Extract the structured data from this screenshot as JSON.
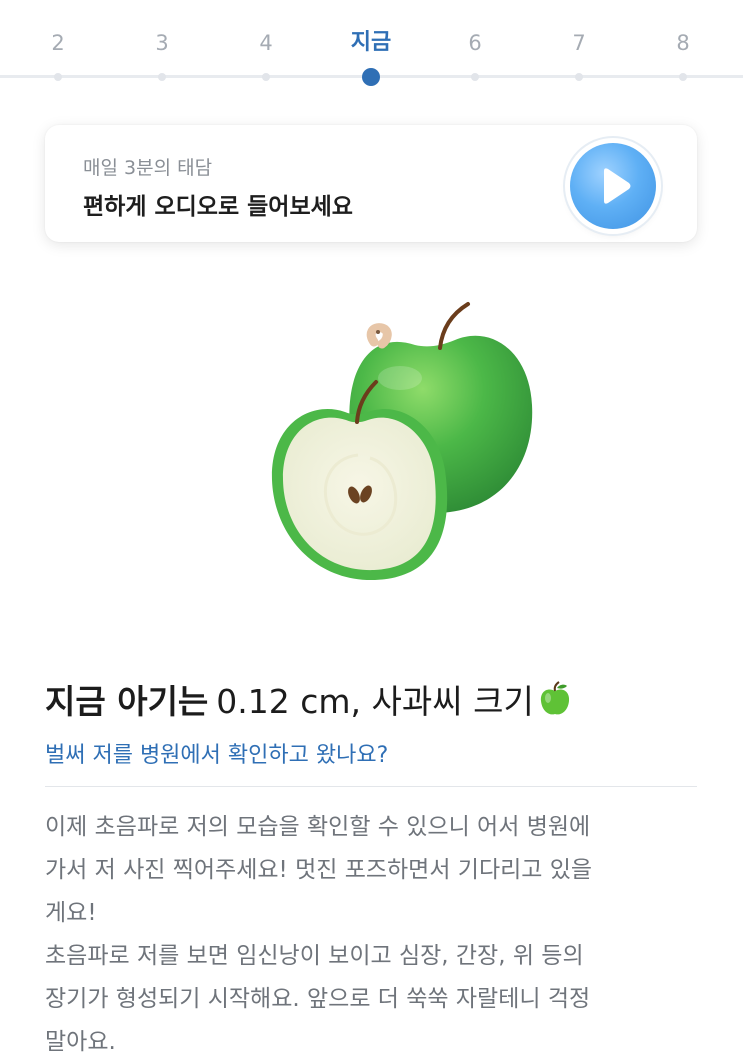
{
  "weeks": [
    {
      "label": "2",
      "active": false
    },
    {
      "label": "3",
      "active": false
    },
    {
      "label": "4",
      "active": false
    },
    {
      "label": "지금",
      "active": true
    },
    {
      "label": "6",
      "active": false
    },
    {
      "label": "7",
      "active": false
    },
    {
      "label": "8",
      "active": false
    }
  ],
  "audio": {
    "subtitle": "매일 3분의 태담",
    "title": "편하게 오디오로 들어보세요",
    "play_icon": "play-icon"
  },
  "illustration": {
    "icon": "green-apple-illustration"
  },
  "info": {
    "headline_bold": "지금 아기는",
    "headline_size": "0.12 cm, 사과씨 크기",
    "headline_emoji": "green-apple-icon",
    "question": "벌써 저를 병원에서 확인하고 왔나요?",
    "lines": [
      "이제 초음파로 저의 모습을 확인할 수 있으니 어서 병원에",
      "가서 저 사진 찍어주세요! 멋진 포즈하면서 기다리고 있을",
      "게요!",
      "초음파로 저를 보면 임신낭이 보이고 심장, 간장, 위 등의",
      "장기가 형성되기 시작해요. 앞으로 더 쑥쑥 자랄테니 걱정",
      "말아요."
    ]
  },
  "colors": {
    "accent": "#2f6fb5",
    "muted_text": "#6f747b",
    "apple_green": "#4cb848"
  }
}
